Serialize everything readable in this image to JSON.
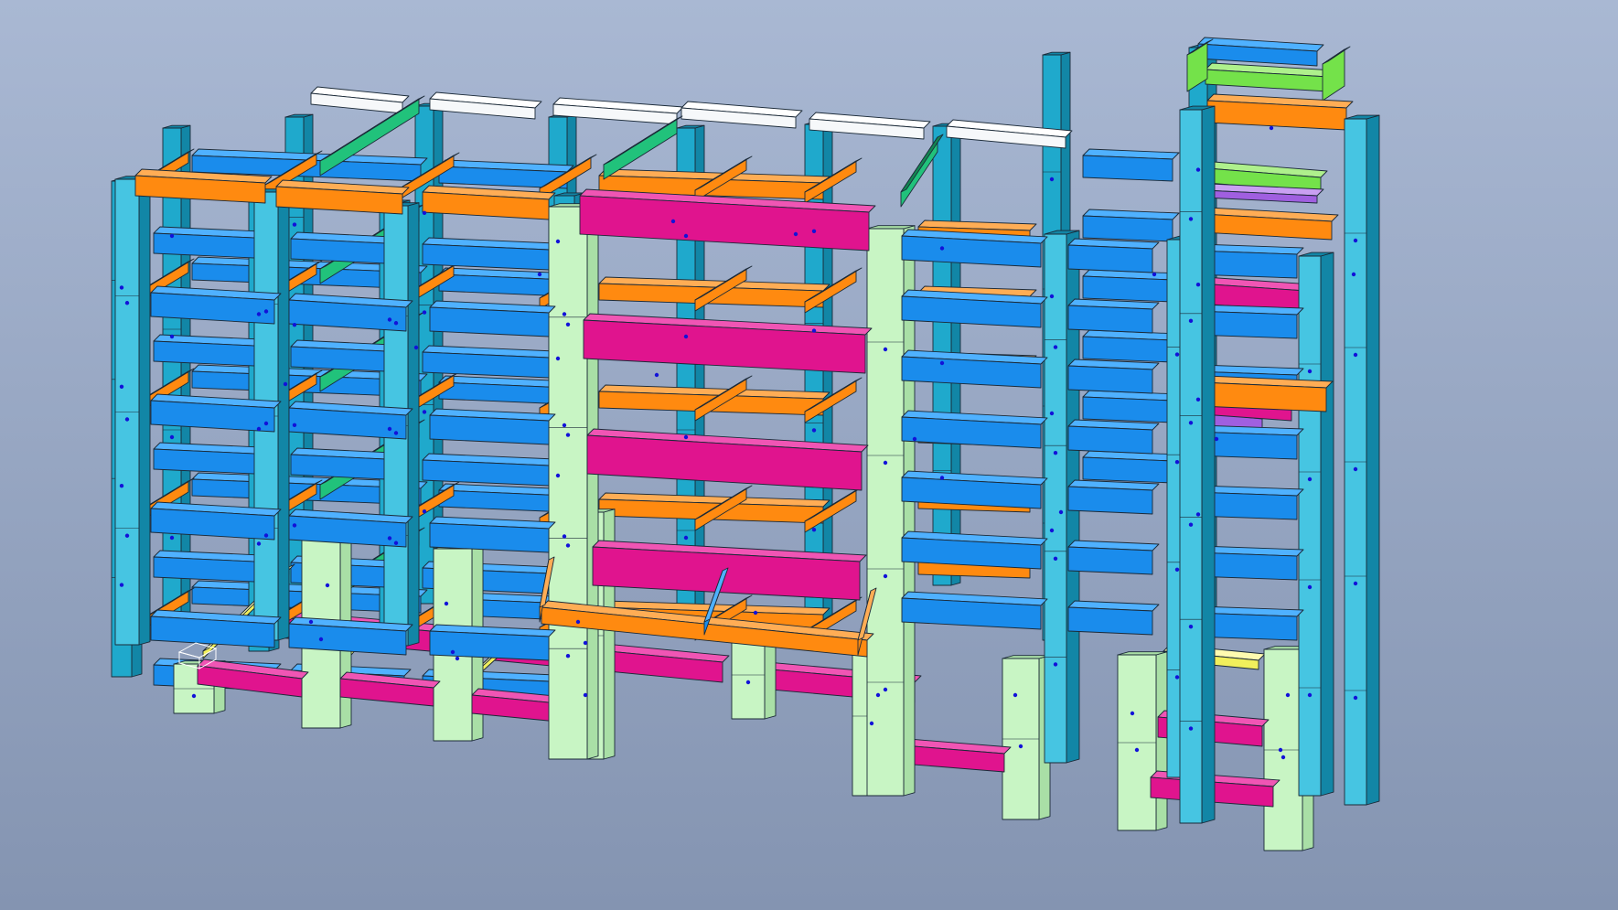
{
  "viewport": {
    "background_top": "#a9b8d3",
    "background_bottom": "#8494b1"
  },
  "model": {
    "type": "3d-structural-frame",
    "member_colors": {
      "column_cyan": "#1fa9cc",
      "column_cyan_light": "#46c5e2",
      "column_cyan_dark": "#1286a6",
      "pier_mint": "#c8f5c4",
      "pier_mint_shade": "#a9dfa6",
      "beam_blue": "#1a8cec",
      "beam_blue_top": "#4fb1ff",
      "beam_blue_dark": "#0d62b3",
      "beam_orange": "#ff8a10",
      "beam_orange_top": "#ffad55",
      "beam_orange_dark": "#b85d00",
      "beam_magenta": "#e0148e",
      "beam_magenta_top": "#f055b4",
      "beam_magenta_dark": "#9a0a60",
      "beam_green": "#21c27b",
      "beam_green_dark": "#138552",
      "beam_lime": "#74e24a",
      "beam_white": "#f6f8fa",
      "beam_yellow": "#f1ef5c",
      "beam_purple": "#a05fe0",
      "node_dot": "#1212d8",
      "edge": "#1b2a38"
    },
    "icons": [
      "view-cube-icon"
    ]
  }
}
